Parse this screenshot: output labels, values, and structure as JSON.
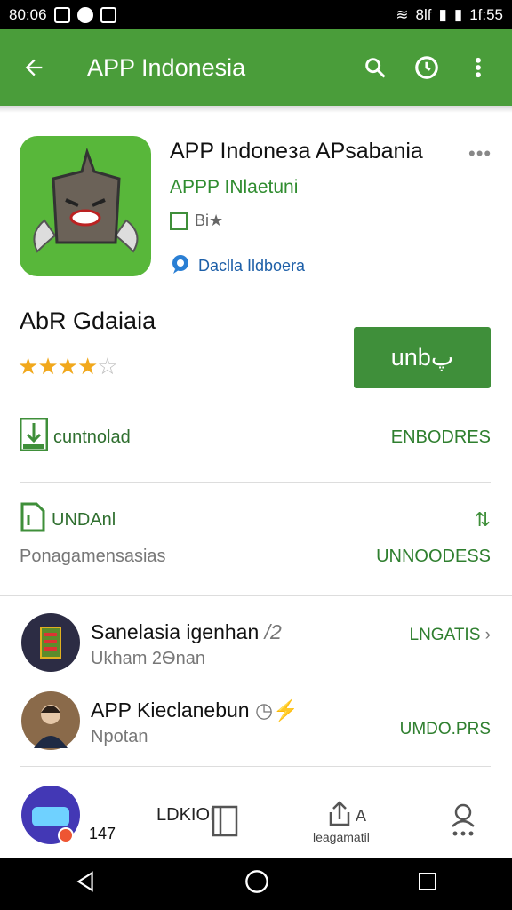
{
  "status": {
    "time_left": "80:06",
    "time_right": "1f:55",
    "signal_text": "8lf"
  },
  "appbar": {
    "title": "APP Indonesia",
    "search_icon": "search-icon",
    "clock_icon": "clock-icon",
    "more_icon": "more-vert-icon"
  },
  "app": {
    "title": "APP Indoneзa APsabania",
    "developer": "APPP INlaetuni",
    "rating_text": "Bi★",
    "category": "Daclla Ildboera",
    "subtitle": "AbR Gdaiaia",
    "rating_fraction": 0.8,
    "install_label": "unbپ"
  },
  "rows": [
    {
      "label": "cuntnolad",
      "action": "ENBODRES"
    },
    {
      "label": "UNDAnl",
      "action": "UNNOODESS",
      "desc": "Ponagamensasias"
    }
  ],
  "list": [
    {
      "title": "Sanelasia igenhan",
      "badge": "/2",
      "sub": "Ukham 2Ѳnan",
      "action": "LNGATIS"
    },
    {
      "title": "APP Kieclanebun",
      "sub": "Npotan",
      "action": "UMDO.PRS"
    }
  ],
  "bottom": {
    "counter": "147",
    "left_label": "LDKIOI",
    "right_label": "leagamatil",
    "right_top": "A"
  },
  "colors": {
    "primary": "#4a9d3a",
    "accent": "#3f8f3a"
  }
}
